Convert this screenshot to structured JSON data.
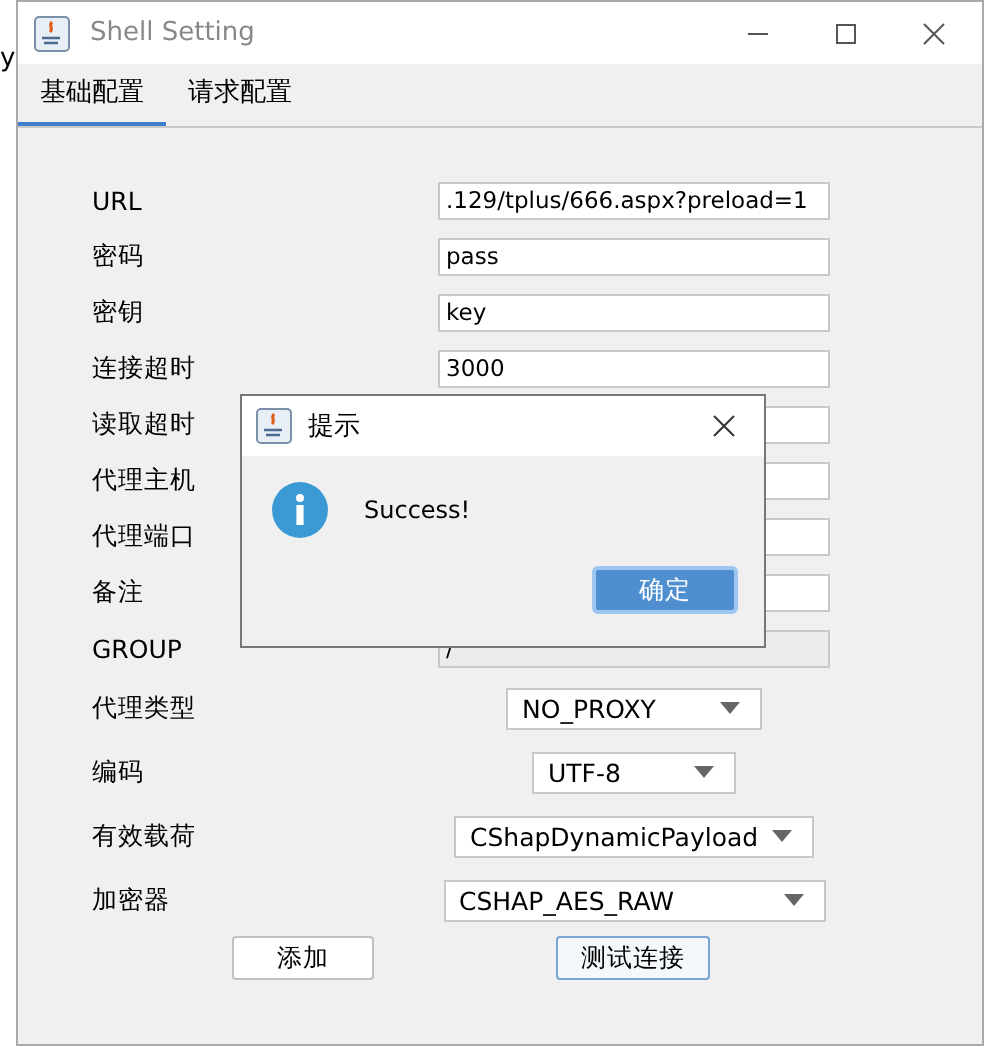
{
  "background_text": "y",
  "window": {
    "title": "Shell Setting"
  },
  "tabs": [
    {
      "label": "基础配置",
      "selected": true
    },
    {
      "label": "请求配置",
      "selected": false
    }
  ],
  "fields": [
    {
      "label": "URL",
      "value": ".129/tplus/666.aspx?preload=1",
      "disabled": false
    },
    {
      "label": "密码",
      "value": "pass",
      "disabled": false
    },
    {
      "label": "密钥",
      "value": "key",
      "disabled": false
    },
    {
      "label": "连接超时",
      "value": "3000",
      "disabled": false
    },
    {
      "label": "读取超时",
      "disabled": false
    },
    {
      "label": "代理主机",
      "disabled": false
    },
    {
      "label": "代理端口",
      "disabled": false
    },
    {
      "label": "备注",
      "disabled": false
    },
    {
      "label": "GROUP",
      "value": "/",
      "disabled": true
    }
  ],
  "selects": [
    {
      "label": "代理类型",
      "value": "NO_PROXY"
    },
    {
      "label": "编码",
      "value": "UTF-8"
    },
    {
      "label": "有效载荷",
      "value": "CShapDynamicPayload"
    },
    {
      "label": "加密器",
      "value": "CSHAP_AES_RAW"
    }
  ],
  "buttons": [
    {
      "label": "添加",
      "focused": false
    },
    {
      "label": "测试连接",
      "focused": true
    }
  ],
  "dialog": {
    "title": "提示",
    "message": "Success!",
    "button": "确定"
  }
}
